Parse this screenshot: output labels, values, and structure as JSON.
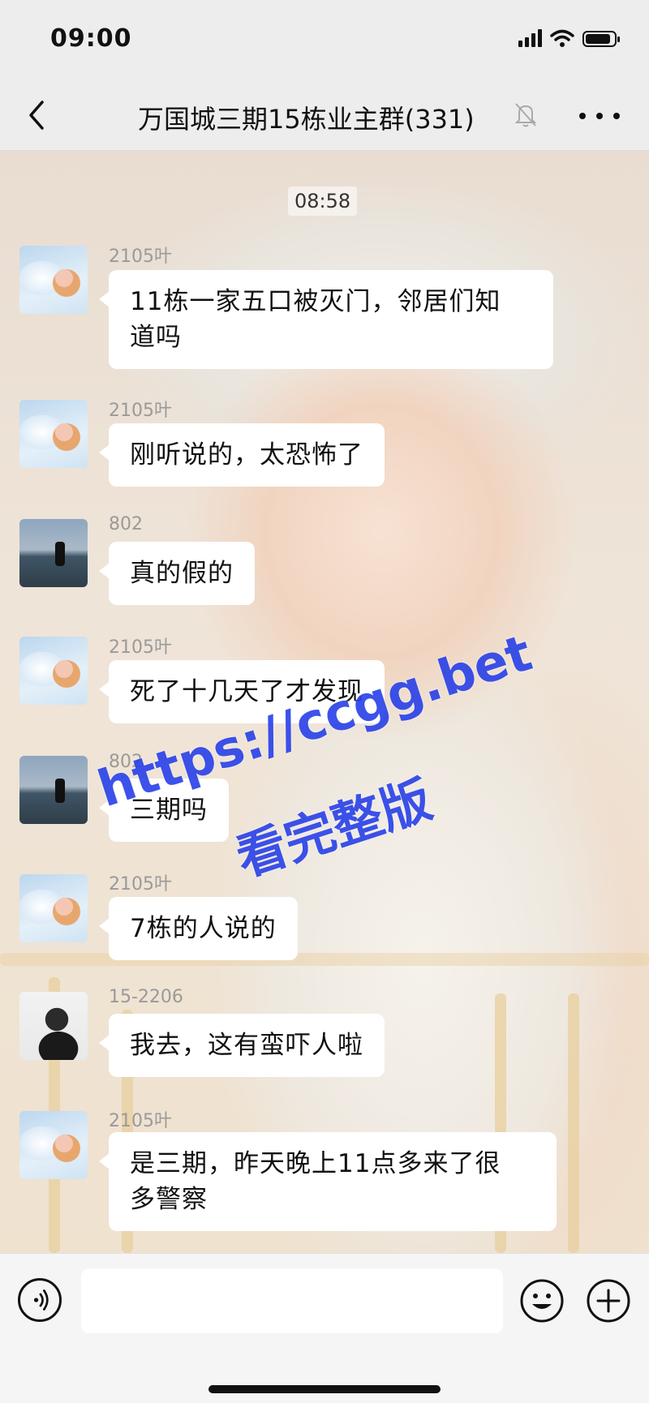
{
  "status_bar": {
    "time": "09:00"
  },
  "header": {
    "title": "万国城三期15栋业主群(331)"
  },
  "chat": {
    "timestamp": "08:58",
    "messages": [
      {
        "sender": "2105叶",
        "text_line1": "11栋一家五口被灭门，邻居们知",
        "text_line2": "道吗"
      },
      {
        "sender": "2105叶",
        "text": "刚听说的，太恐怖了"
      },
      {
        "sender": "802",
        "text": "真的假的"
      },
      {
        "sender": "2105叶",
        "text": "死了十几天了才发现"
      },
      {
        "sender": "802",
        "text": "三期吗"
      },
      {
        "sender": "2105叶",
        "text": "7栋的人说的"
      },
      {
        "sender": "15-2206",
        "text": "我去，这有蛮吓人啦"
      },
      {
        "sender": "2105叶",
        "text_line1": "是三期，昨天晚上11点多来了很",
        "text_line2": "多警察"
      }
    ]
  },
  "watermark": {
    "line1": "https://ccgg.bet",
    "line2": "看完整版"
  },
  "input": {
    "value": ""
  },
  "colors": {
    "bar_bg": "#ededed",
    "bubble_bg": "#ffffff",
    "watermark": "#2840e8"
  }
}
